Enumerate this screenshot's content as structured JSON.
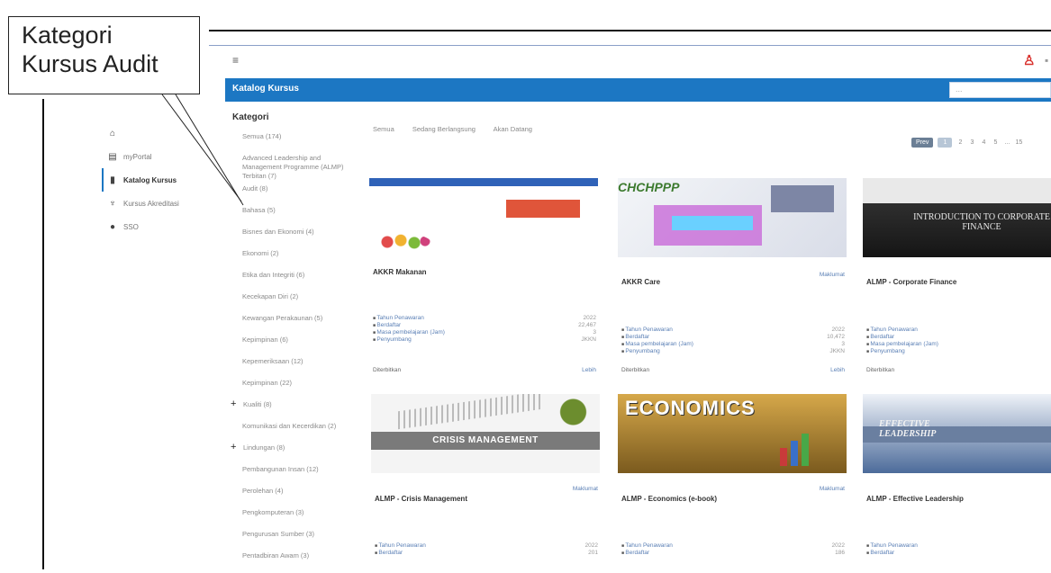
{
  "callout": {
    "line1": "Kategori",
    "line2": "Kursus Audit"
  },
  "header": {
    "menu_icon": "≡",
    "title": "Katalog Kursus",
    "search_placeholder": "...",
    "user_icon": "user-icon"
  },
  "nav": {
    "items": [
      {
        "icon": "home-icon",
        "glyph": "⌂",
        "label": ""
      },
      {
        "icon": "calendar-icon",
        "glyph": "▤",
        "label": "myPortal"
      },
      {
        "icon": "book-icon",
        "glyph": "▮",
        "label": "Katalog Kursus"
      },
      {
        "icon": "trophy-icon",
        "glyph": "♆",
        "label": "Kursus Akreditasi"
      },
      {
        "icon": "globe-icon",
        "glyph": "●",
        "label": "SSO"
      }
    ]
  },
  "kategori": {
    "title": "Kategori",
    "items": [
      {
        "label": "Semua (174)",
        "plus": false
      },
      {
        "label": "Advanced Leadership and Management Programme (ALMP) Terbitan (7)",
        "plus": false
      },
      {
        "label": "Audit (8)",
        "plus": false
      },
      {
        "label": "Bahasa (5)",
        "plus": false
      },
      {
        "label": "Bisnes dan Ekonomi (4)",
        "plus": false
      },
      {
        "label": "Ekonomi (2)",
        "plus": false
      },
      {
        "label": "Etika dan Integriti (6)",
        "plus": false
      },
      {
        "label": "Kecekapan Diri (2)",
        "plus": false
      },
      {
        "label": "Kewangan Perakaunan (5)",
        "plus": false
      },
      {
        "label": "Kepimpinan (6)",
        "plus": false
      },
      {
        "label": "Kepemeriksaan (12)",
        "plus": false
      },
      {
        "label": "Kepimpinan (22)",
        "plus": false
      },
      {
        "label": "Kualiti (8)",
        "plus": true
      },
      {
        "label": "Komunikasi dan Kecerdikan (2)",
        "plus": false
      },
      {
        "label": "Lindungan (8)",
        "plus": true
      },
      {
        "label": "Pembangunan Insan (12)",
        "plus": false
      },
      {
        "label": "Perolehan (4)",
        "plus": false
      },
      {
        "label": "Pengkomputeran (3)",
        "plus": false
      },
      {
        "label": "Pengurusan Sumber (3)",
        "plus": false
      },
      {
        "label": "Pentadbiran Awam (3)",
        "plus": false
      }
    ]
  },
  "tabs": [
    "Semua",
    "Sedang Berlangsung",
    "Akan Datang"
  ],
  "pager": {
    "first": "Prev",
    "current": "1",
    "pages": [
      "2",
      "3",
      "4",
      "5",
      "...",
      "15"
    ]
  },
  "cards": [
    {
      "title": "AKKR Makanan",
      "link": "Maklumat",
      "image": "food-banner",
      "meta": [
        {
          "label": "Tahun Penawaran",
          "value": "2022"
        },
        {
          "label": "Berdaftar",
          "value": "22,467"
        },
        {
          "label": "Masa pembelajaran (Jam)",
          "value": "3"
        },
        {
          "label": "Penyumbang",
          "value": "JKKN"
        }
      ],
      "foot": {
        "left": "Diterbitkan",
        "right": "Lebih"
      }
    },
    {
      "title": "AKKR Care",
      "link": "Maklumat",
      "image": "care-banner",
      "meta": [
        {
          "label": "Tahun Penawaran",
          "value": "2022"
        },
        {
          "label": "Berdaftar",
          "value": "10,472"
        },
        {
          "label": "Masa pembelajaran (Jam)",
          "value": "3"
        },
        {
          "label": "Penyumbang",
          "value": "JKKN"
        }
      ],
      "foot": {
        "left": "Diterbitkan",
        "right": "Lebih"
      }
    },
    {
      "title": "ALMP - Corporate Finance",
      "link": "Maklumat",
      "image": "INTRODUCTION TO CORPORATE FINANCE",
      "meta": [
        {
          "label": "Tahun Penawaran",
          "value": ""
        },
        {
          "label": "Berdaftar",
          "value": ""
        },
        {
          "label": "Masa pembelajaran (Jam)",
          "value": ""
        },
        {
          "label": "Penyumbang",
          "value": ""
        }
      ],
      "foot": {
        "left": "Diterbitkan",
        "right": ""
      }
    },
    {
      "title": "ALMP - Crisis Management",
      "link": "Maklumat",
      "image": "CRISIS MANAGEMENT",
      "meta": [
        {
          "label": "Tahun Penawaran",
          "value": "2022"
        },
        {
          "label": "Berdaftar",
          "value": "201"
        }
      ],
      "foot": {
        "left": "",
        "right": ""
      }
    },
    {
      "title": "ALMP - Economics (e-book)",
      "link": "Maklumat",
      "image": "ECONOMICS",
      "meta": [
        {
          "label": "Tahun Penawaran",
          "value": "2022"
        },
        {
          "label": "Berdaftar",
          "value": "186"
        }
      ],
      "foot": {
        "left": "",
        "right": ""
      }
    },
    {
      "title": "ALMP - Effective Leadership",
      "link": "Maklumat",
      "image": "EFFECTIVE LEADERSHIP",
      "meta": [
        {
          "label": "Tahun Penawaran",
          "value": ""
        },
        {
          "label": "Berdaftar",
          "value": ""
        }
      ],
      "foot": {
        "left": "",
        "right": ""
      }
    }
  ],
  "colors": {
    "brand": "#1c77c3",
    "alert": "#d9302c"
  }
}
